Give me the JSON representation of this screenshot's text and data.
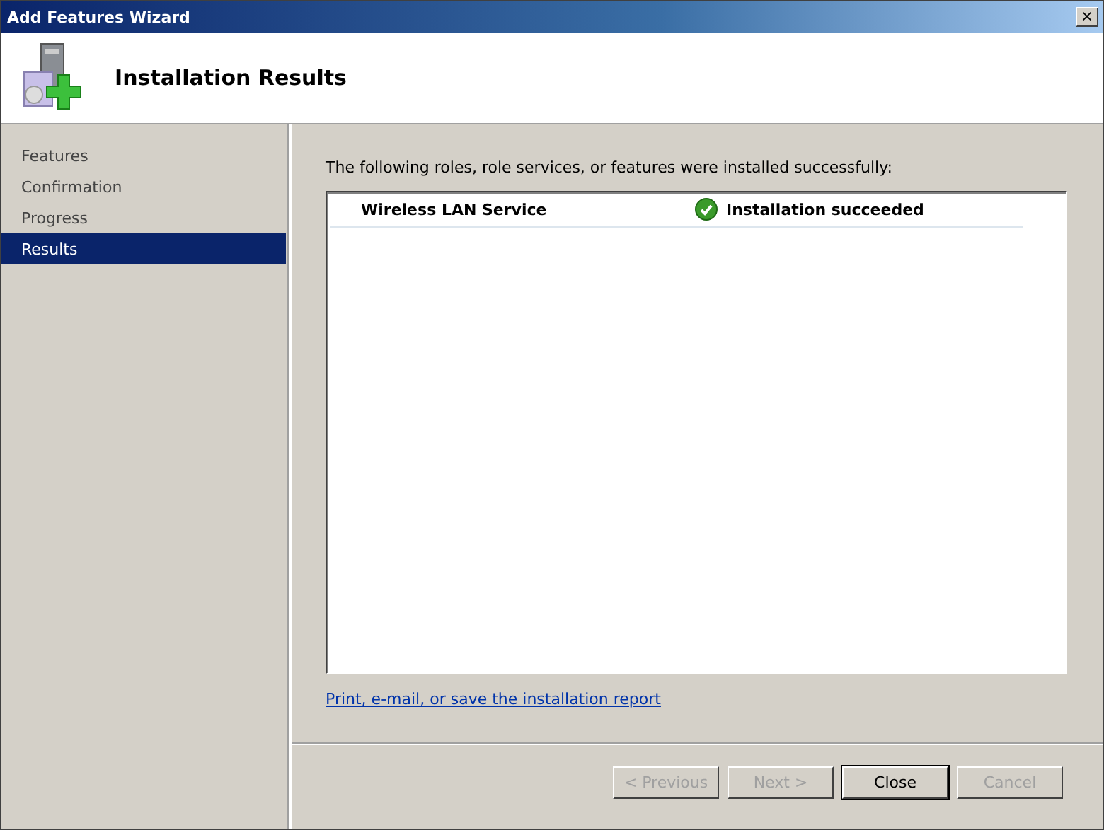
{
  "window": {
    "title": "Add Features Wizard",
    "close": "×"
  },
  "header": {
    "title": "Installation Results"
  },
  "sidebar": {
    "items": [
      {
        "label": "Features",
        "selected": false
      },
      {
        "label": "Confirmation",
        "selected": false
      },
      {
        "label": "Progress",
        "selected": false
      },
      {
        "label": "Results",
        "selected": true
      }
    ]
  },
  "content": {
    "intro": "The following roles, role services, or features were installed successfully:",
    "results": [
      {
        "name": "Wireless LAN Service",
        "status": "Installation succeeded",
        "kind": "success"
      }
    ],
    "report_link": "Print, e-mail, or save the installation report"
  },
  "buttons": [
    {
      "label": "< Previous",
      "disabled": true,
      "default": false
    },
    {
      "label": "Next >",
      "disabled": true,
      "default": false
    },
    {
      "label": "Close",
      "disabled": false,
      "default": true
    },
    {
      "label": "Cancel",
      "disabled": true,
      "default": false
    }
  ]
}
